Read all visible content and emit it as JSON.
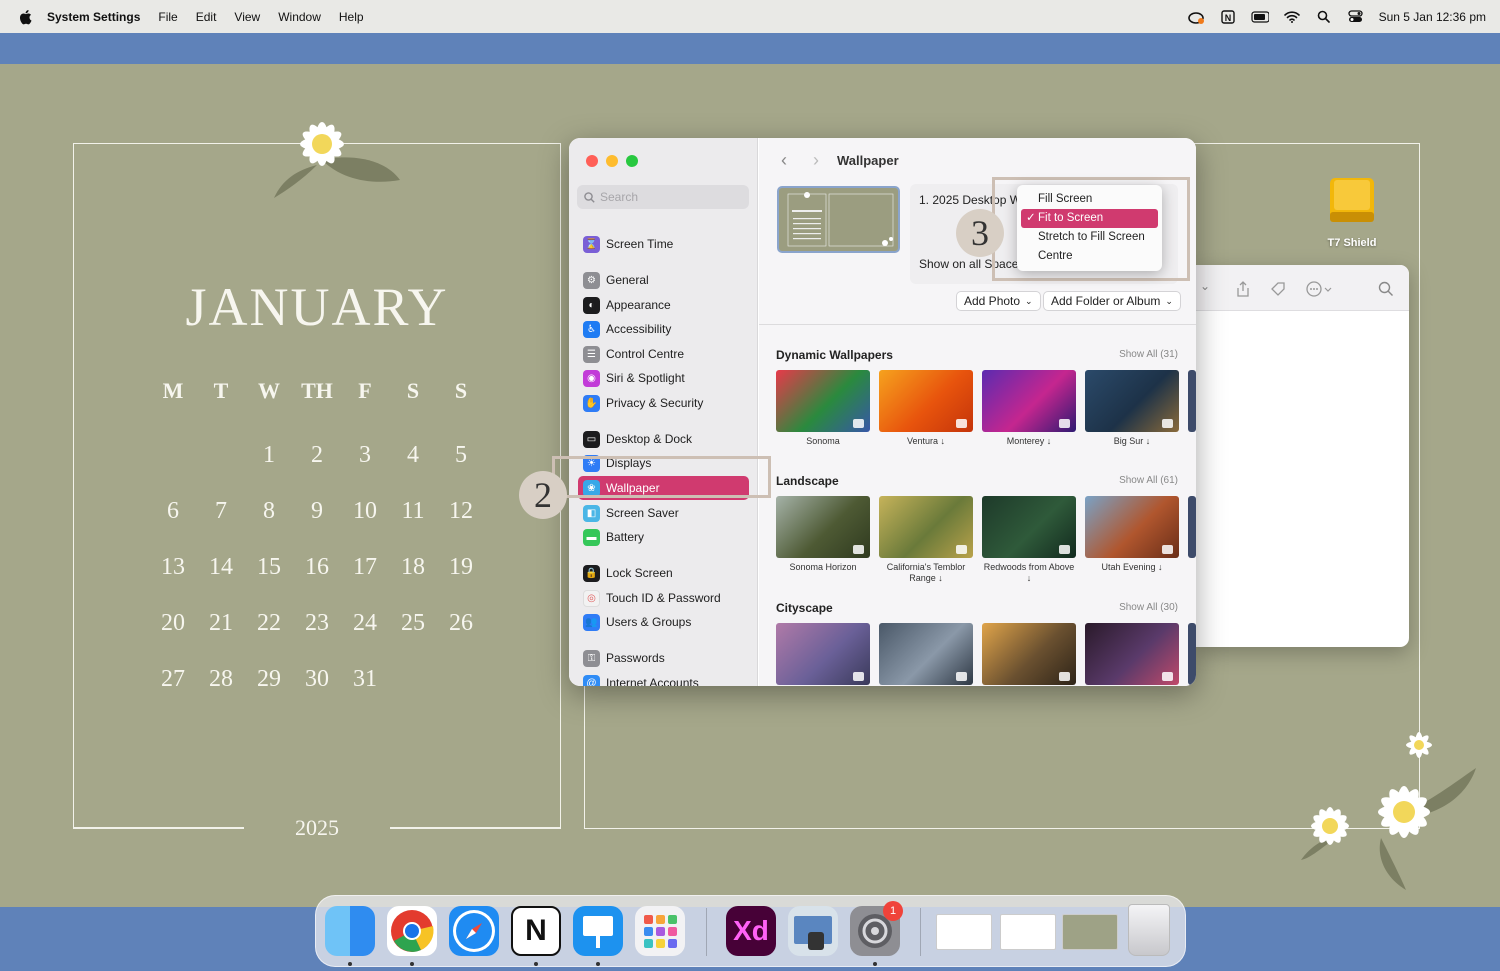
{
  "menubar": {
    "app": "System Settings",
    "items": [
      "File",
      "Edit",
      "View",
      "Window",
      "Help"
    ],
    "clock": "Sun 5 Jan  12:36 pm"
  },
  "calendar": {
    "month": "JANUARY",
    "year": "2025",
    "weekdays": [
      "M",
      "T",
      "W",
      "TH",
      "F",
      "S",
      "S"
    ],
    "days": [
      "",
      "",
      "1",
      "2",
      "3",
      "4",
      "5",
      "6",
      "7",
      "8",
      "9",
      "10",
      "11",
      "12",
      "13",
      "14",
      "15",
      "16",
      "17",
      "18",
      "19",
      "20",
      "21",
      "22",
      "23",
      "24",
      "25",
      "26",
      "27",
      "28",
      "29",
      "30",
      "31"
    ]
  },
  "settings": {
    "search_placeholder": "Search",
    "sidebar": [
      {
        "label": "Screen Time",
        "icon": "hourglass-icon",
        "color": "#7a5fd6"
      },
      {
        "label": "General",
        "icon": "gear-icon",
        "color": "#8e8e93"
      },
      {
        "label": "Appearance",
        "icon": "appearance-icon",
        "color": "#1c1c1e"
      },
      {
        "label": "Accessibility",
        "icon": "accessibility-icon",
        "color": "#1f7cf3"
      },
      {
        "label": "Control Centre",
        "icon": "control-centre-icon",
        "color": "#8e8e93"
      },
      {
        "label": "Siri & Spotlight",
        "icon": "siri-icon",
        "color": "#c23bd8"
      },
      {
        "label": "Privacy & Security",
        "icon": "hand-icon",
        "color": "#2f7cf6"
      },
      {
        "label": "Desktop & Dock",
        "icon": "dock-icon",
        "color": "#1c1c1e"
      },
      {
        "label": "Displays",
        "icon": "display-icon",
        "color": "#2f7cf6"
      },
      {
        "label": "Wallpaper",
        "icon": "wallpaper-icon",
        "color": "#37a8e8"
      },
      {
        "label": "Screen Saver",
        "icon": "screensaver-icon",
        "color": "#4bb6e6"
      },
      {
        "label": "Battery",
        "icon": "battery-icon",
        "color": "#35c759"
      },
      {
        "label": "Lock Screen",
        "icon": "lock-icon",
        "color": "#1c1c1e"
      },
      {
        "label": "Touch ID & Password",
        "icon": "fingerprint-icon",
        "color": "#f2f2f2"
      },
      {
        "label": "Users & Groups",
        "icon": "users-icon",
        "color": "#2f7cf6"
      },
      {
        "label": "Passwords",
        "icon": "key-icon",
        "color": "#8e8e93"
      },
      {
        "label": "Internet Accounts",
        "icon": "at-icon",
        "color": "#2f8cf6"
      }
    ],
    "title": "Wallpaper",
    "wallpaper_name": "1. 2025 Desktop W",
    "show_all_spaces": "Show on all Spaces",
    "add_photo": "Add Photo",
    "add_folder": "Add Folder or Album",
    "fit_menu": [
      "Fill Screen",
      "Fit to Screen",
      "Stretch to Fill Screen",
      "Centre"
    ],
    "fit_selected_index": 1,
    "fit_check": "✓",
    "sections": [
      {
        "title": "Dynamic Wallpapers",
        "show_all": "Show All (31)",
        "items": [
          {
            "label": "Sonoma",
            "colors": [
              "#e8394a",
              "#2a8a3e",
              "#3757a8"
            ]
          },
          {
            "label": "Ventura ↓",
            "colors": [
              "#f6a21e",
              "#e8540d",
              "#c4340a"
            ]
          },
          {
            "label": "Monterey ↓",
            "colors": [
              "#5b2bb0",
              "#c5268f",
              "#2e1a72"
            ]
          },
          {
            "label": "Big Sur ↓",
            "colors": [
              "#2b4a6a",
              "#1d3248",
              "#8a6a3a"
            ]
          }
        ]
      },
      {
        "title": "Landscape",
        "show_all": "Show All (61)",
        "items": [
          {
            "label": "Sonoma Horizon",
            "colors": [
              "#a5b2a8",
              "#4e5a34",
              "#2f3a1f"
            ]
          },
          {
            "label": "California's Temblor Range ↓",
            "colors": [
              "#c6b35a",
              "#6a7a3a",
              "#b9a24a"
            ]
          },
          {
            "label": "Redwoods from Above ↓",
            "colors": [
              "#1e3a2a",
              "#2f5a3a",
              "#122a1e"
            ]
          },
          {
            "label": "Utah Evening ↓",
            "colors": [
              "#7aa2c6",
              "#b0562e",
              "#6a2e18"
            ]
          }
        ]
      },
      {
        "title": "Cityscape",
        "show_all": "Show All (30)",
        "items": [
          {
            "label": "",
            "colors": [
              "#b07aa8",
              "#6a6098",
              "#3a3a5a"
            ]
          },
          {
            "label": "",
            "colors": [
              "#4a5868",
              "#8a98a8",
              "#2e3844"
            ]
          },
          {
            "label": "",
            "colors": [
              "#e0a44a",
              "#6a5030",
              "#2e2418"
            ]
          },
          {
            "label": "",
            "colors": [
              "#2a1a2a",
              "#5a3a6a",
              "#c04a6a"
            ]
          }
        ]
      }
    ]
  },
  "annotations": {
    "step2": "2",
    "step3": "3"
  },
  "desktop": {
    "drive_label": "T7 Shield"
  },
  "dock": {
    "apps": [
      {
        "name": "finder",
        "color": "#2f8cf0"
      },
      {
        "name": "chrome",
        "color": "#ffffff"
      },
      {
        "name": "safari",
        "color": "#1f8bf2"
      },
      {
        "name": "notion",
        "color": "#ffffff",
        "text": "N"
      },
      {
        "name": "keynote",
        "color": "#1d92ef"
      },
      {
        "name": "launchpad",
        "color": "#f2f2f4"
      },
      {
        "name": "adobe-xd",
        "color": "#470137",
        "text": "Xd"
      },
      {
        "name": "preview",
        "color": "#d8e2ea"
      },
      {
        "name": "system-settings",
        "color": "#8e8e93"
      }
    ],
    "settings_badge": "1"
  }
}
